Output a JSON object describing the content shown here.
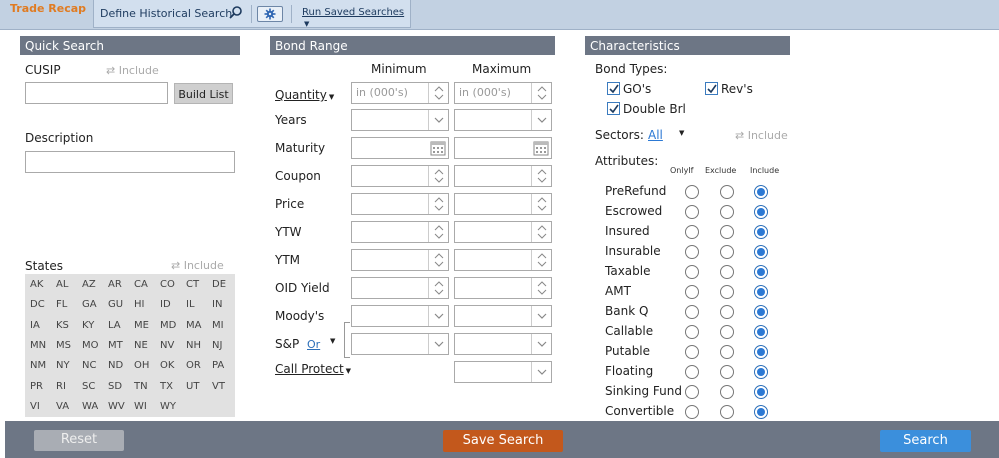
{
  "app": {
    "title": "Trade Recap"
  },
  "toolbar": {
    "define_label": "Define Historical Search",
    "run_saved_label": "Run Saved Searches"
  },
  "quick_search": {
    "header": "Quick Search",
    "cusip_label": "CUSIP",
    "include_label": "Include",
    "build_list_label": "Build List",
    "description_label": "Description",
    "states_label": "States",
    "states": [
      "AK",
      "AL",
      "AZ",
      "AR",
      "CA",
      "CO",
      "CT",
      "DE",
      "DC",
      "FL",
      "GA",
      "GU",
      "HI",
      "ID",
      "IL",
      "IN",
      "IA",
      "KS",
      "KY",
      "LA",
      "ME",
      "MD",
      "MA",
      "MI",
      "MN",
      "MS",
      "MO",
      "MT",
      "NE",
      "NV",
      "NH",
      "NJ",
      "NM",
      "NY",
      "NC",
      "ND",
      "OH",
      "OK",
      "OR",
      "PA",
      "PR",
      "RI",
      "SC",
      "SD",
      "TN",
      "TX",
      "UT",
      "VT",
      "VI",
      "VA",
      "WA",
      "WV",
      "WI",
      "WY"
    ]
  },
  "bond_range": {
    "header": "Bond Range",
    "minimum_label": "Minimum",
    "maximum_label": "Maximum",
    "quantity_placeholder": "in (000's)",
    "rows": {
      "quantity": "Quantity",
      "years": "Years",
      "maturity": "Maturity",
      "coupon": "Coupon",
      "price": "Price",
      "ytw": "YTW",
      "ytm": "YTM",
      "oid_yield": "OID Yield",
      "moodys": "Moody's",
      "sp": "S&P",
      "sp_or": "Or",
      "call_protect": "Call Protect"
    }
  },
  "characteristics": {
    "header": "Characteristics",
    "bond_types_label": "Bond Types:",
    "bond_types": {
      "gos": "GO's",
      "revs": "Rev's",
      "double_brl": "Double Brl"
    },
    "sectors_label": "Sectors:",
    "sectors_value": "All",
    "include_label": "Include",
    "attributes_label": "Attributes:",
    "col_onlyif": "OnlyIf",
    "col_exclude": "Exclude",
    "col_include": "Include",
    "attributes": [
      "PreRefund",
      "Escrowed",
      "Insured",
      "Insurable",
      "Taxable",
      "AMT",
      "Bank Q",
      "Callable",
      "Putable",
      "Floating",
      "Sinking Fund",
      "Convertible"
    ]
  },
  "footer": {
    "reset_label": "Reset",
    "save_search_label": "Save Search",
    "search_label": "Search"
  },
  "colors": {
    "accent_orange": "#c3581c",
    "search_blue": "#3b8fdc",
    "header_gray": "#6d7685",
    "title_orange": "#e07b21"
  }
}
